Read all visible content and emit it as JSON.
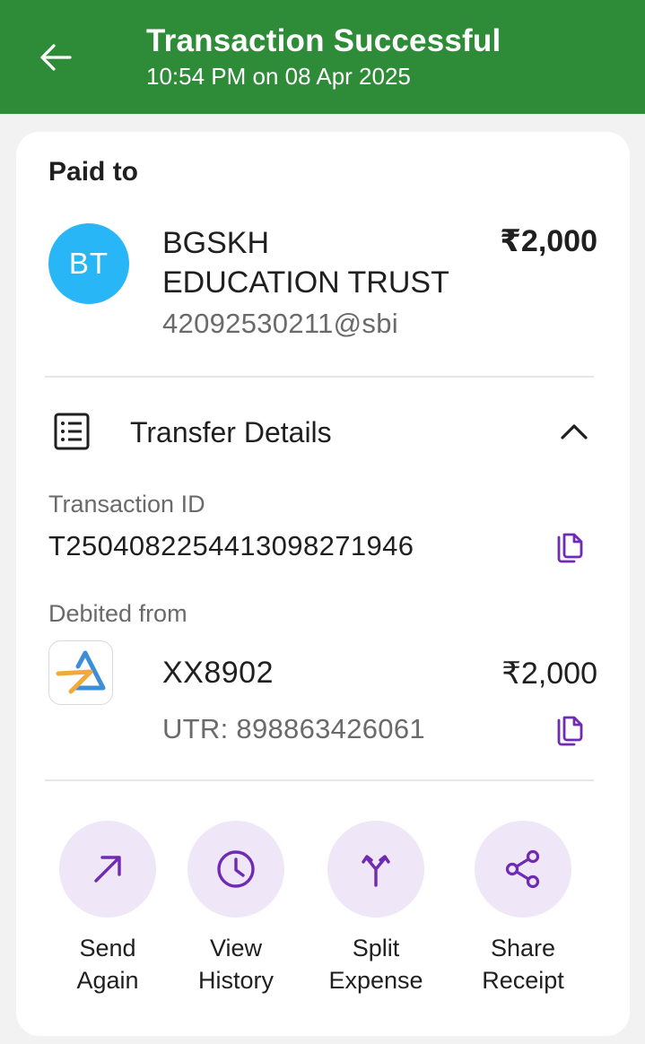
{
  "header": {
    "title": "Transaction Successful",
    "subtitle": "10:54 PM on 08 Apr 2025"
  },
  "paid_to": {
    "label": "Paid to",
    "avatar_initials": "BT",
    "name_line1": "BGSKH",
    "name_line2": "EDUCATION TRUST",
    "vpa": "42092530211@sbi",
    "amount": "₹2,000"
  },
  "transfer_details": {
    "label": "Transfer Details",
    "transaction_id_label": "Transaction ID",
    "transaction_id": "T2504082254413098271946",
    "debited_from_label": "Debited from",
    "account": "XX8902",
    "amount": "₹2,000",
    "utr": "UTR: 898863426061"
  },
  "actions": [
    {
      "line1": "Send",
      "line2": "Again",
      "icon": "arrow-up-right-icon"
    },
    {
      "line1": "View",
      "line2": "History",
      "icon": "clock-icon"
    },
    {
      "line1": "Split",
      "line2": "Expense",
      "icon": "split-icon"
    },
    {
      "line1": "Share",
      "line2": "Receipt",
      "icon": "share-icon"
    }
  ],
  "colors": {
    "header_bg": "#2e8b38",
    "avatar_bg": "#29b6f6",
    "accent_purple": "#6f2bb3",
    "action_circle_bg": "#efe6f8",
    "page_bg": "#f2f2f2"
  }
}
